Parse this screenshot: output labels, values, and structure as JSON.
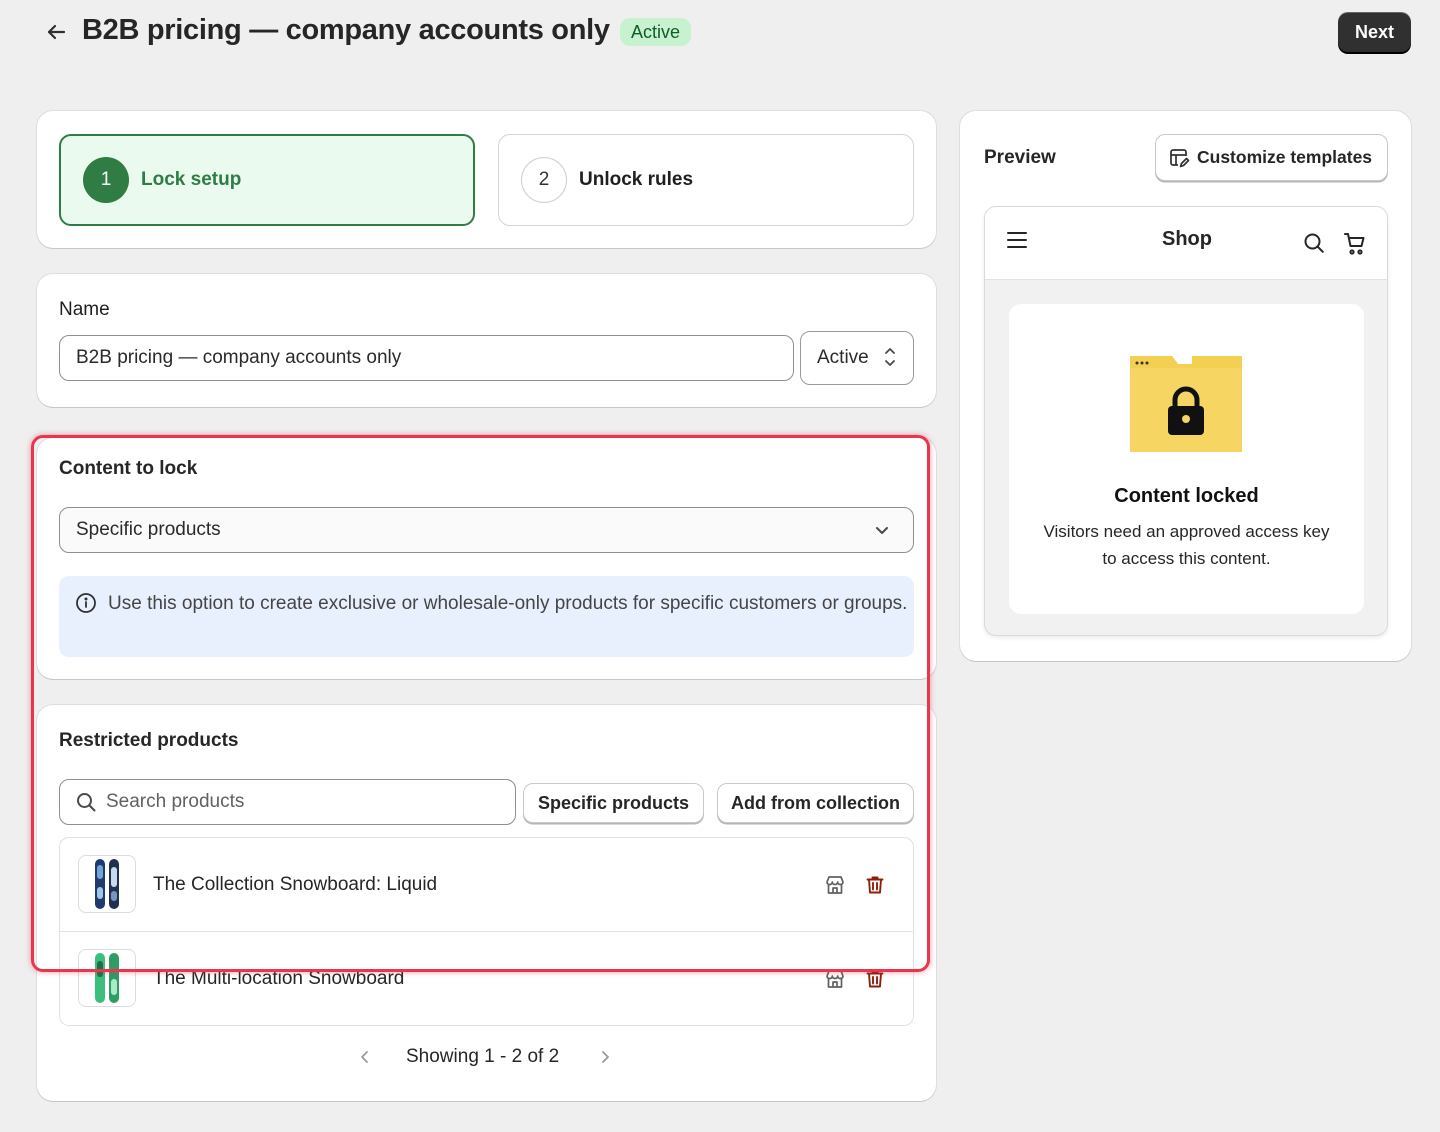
{
  "header": {
    "title": "B2B pricing — company accounts only",
    "badge": "Active",
    "next_label": "Next"
  },
  "steps": [
    {
      "number": "1",
      "label": "Lock setup",
      "active": true
    },
    {
      "number": "2",
      "label": "Unlock rules",
      "active": false
    }
  ],
  "name_section": {
    "label": "Name",
    "value": "B2B pricing — company accounts only",
    "status_value": "Active"
  },
  "content_lock": {
    "title": "Content to lock",
    "selected": "Specific products",
    "info": "Use this option to create exclusive or wholesale-only products for specific customers or groups."
  },
  "restricted": {
    "title": "Restricted products",
    "search_placeholder": "Search products",
    "specific_button": "Specific products",
    "collection_button": "Add from collection",
    "products": [
      {
        "name": "The Collection Snowboard: Liquid",
        "icon": "snowboard-liquid"
      },
      {
        "name": "The Multi-location Snowboard",
        "icon": "snowboard-multilocation"
      }
    ],
    "pagination": "Showing 1 - 2 of 2"
  },
  "preview": {
    "label": "Preview",
    "customize_button": "Customize templates",
    "shop_title": "Shop",
    "locked_title": "Content locked",
    "locked_desc": "Visitors need an approved access key to access this content."
  },
  "colors": {
    "accent_green": "#2f7d45",
    "badge_bg": "#c8f2cf",
    "highlight": "#e8364e",
    "info_bg": "#e9f0fd",
    "danger": "#8e1f0b"
  }
}
